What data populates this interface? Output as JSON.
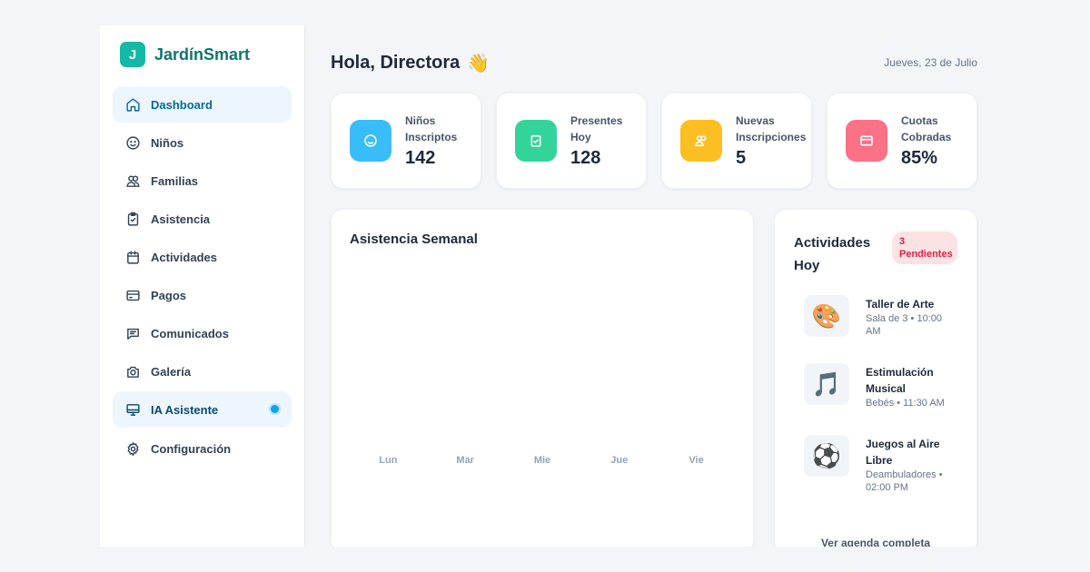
{
  "brand": {
    "logo_letter": "J",
    "name": "JardínSmart"
  },
  "sidebar": {
    "items": [
      {
        "label": "Dashboard",
        "icon": "home-icon"
      },
      {
        "label": "Niños",
        "icon": "smile-icon"
      },
      {
        "label": "Familias",
        "icon": "users-icon"
      },
      {
        "label": "Asistencia",
        "icon": "clipboard-check-icon"
      },
      {
        "label": "Actividades",
        "icon": "calendar-icon"
      },
      {
        "label": "Pagos",
        "icon": "credit-card-icon"
      },
      {
        "label": "Comunicados",
        "icon": "message-icon"
      },
      {
        "label": "Galería",
        "icon": "camera-icon"
      },
      {
        "label": "IA Asistente",
        "icon": "monitor-icon"
      },
      {
        "label": "Configuración",
        "icon": "gear-icon"
      }
    ]
  },
  "header": {
    "greeting": "Hola, Directora",
    "wave": "👋",
    "date": "Jueves, 23 de Julio"
  },
  "stats": [
    {
      "label": "Niños Inscriptos",
      "value": "142",
      "color": "#38bdf8",
      "icon": "smile-icon"
    },
    {
      "label": "Presentes Hoy",
      "value": "128",
      "color": "#34d399",
      "icon": "clipboard-check-icon"
    },
    {
      "label": "Nuevas Inscripciones",
      "value": "5",
      "color": "#fbbf24",
      "icon": "users-icon"
    },
    {
      "label": "Cuotas Cobradas",
      "value": "85%",
      "color": "#fb7185",
      "icon": "credit-card-icon"
    }
  ],
  "attendance": {
    "title": "Asistencia Semanal",
    "days": [
      "Lun",
      "Mar",
      "Mie",
      "Jue",
      "Vie"
    ]
  },
  "activities": {
    "title": "Actividades Hoy",
    "badge": "3 Pendientes",
    "items": [
      {
        "name": "Taller de Arte",
        "meta": "Sala de 3 • 10:00 AM",
        "emoji": "🎨"
      },
      {
        "name": "Estimulación Musical",
        "meta": "Bebés • 11:30 AM",
        "emoji": "🎵"
      },
      {
        "name": "Juegos al Aire Libre",
        "meta": "Deambuladores • 02:00 PM",
        "emoji": "⚽"
      }
    ],
    "link": "Ver agenda completa"
  }
}
